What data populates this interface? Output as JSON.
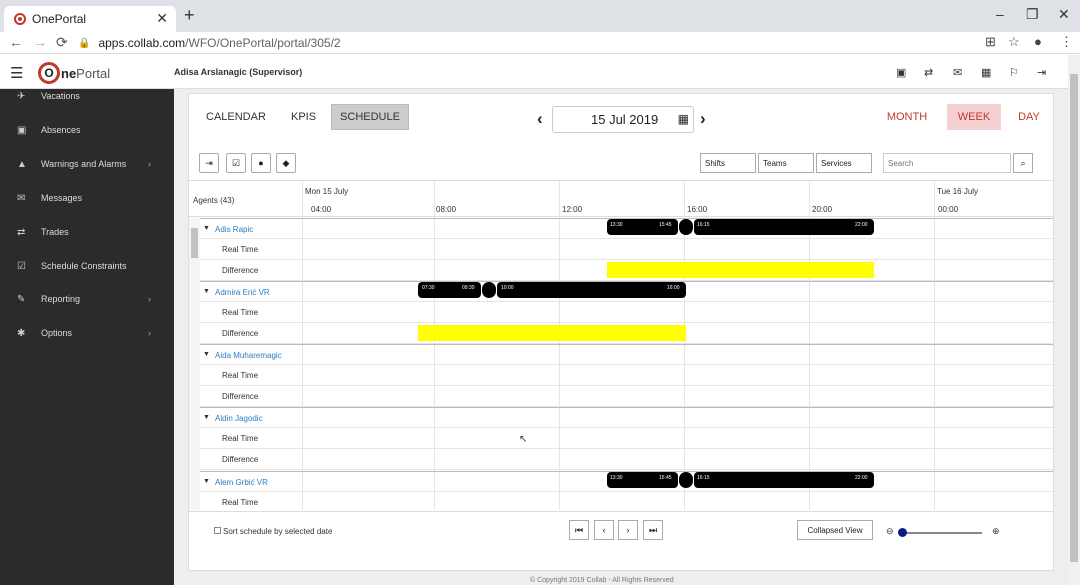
{
  "browser": {
    "tab_title": "OnePortal",
    "url_host": "apps.collab.com",
    "url_path": "/WFO/OnePortal/portal/305/2"
  },
  "app": {
    "logo_letter": "O",
    "logo_text_1": "ne",
    "logo_text_2": "Portal",
    "user_label": "Adisa Arslanagic (Supervisor)"
  },
  "sidebar": {
    "items": [
      {
        "label": "Vacations",
        "icon": "plane-icon"
      },
      {
        "label": "Absences",
        "icon": "calendar-x-icon"
      },
      {
        "label": "Warnings and Alarms",
        "icon": "warning-icon"
      },
      {
        "label": "Messages",
        "icon": "envelope-icon"
      },
      {
        "label": "Trades",
        "icon": "swap-icon"
      },
      {
        "label": "Schedule Constraints",
        "icon": "calendar-check-icon"
      },
      {
        "label": "Reporting",
        "icon": "edit-icon"
      },
      {
        "label": "Options",
        "icon": "gear-icon"
      }
    ]
  },
  "toolbar": {
    "calendar": "CALENDAR",
    "kpis": "KPIS",
    "schedule": "SCHEDULE",
    "date": "15 Jul 2019",
    "month": "MONTH",
    "week": "WEEK",
    "day": "DAY",
    "shifts": "Shifts",
    "teams": "Teams",
    "services": "Services",
    "search_placeholder": "Search"
  },
  "grid": {
    "agents_header": "Agents (43)",
    "day1": "Mon 15 July",
    "day2": "Tue 16 July",
    "hours": [
      "04:00",
      "08:00",
      "12:00",
      "16:00",
      "20:00",
      "00:00"
    ],
    "sub_real": "Real Time",
    "sub_diff": "Difference",
    "agents": [
      {
        "name": "Adis Rapic",
        "shift": [
          "13:30",
          "15:45",
          "16:15",
          "22:00"
        ]
      },
      {
        "name": "Admira Erić VR",
        "shift": [
          "07:30",
          "09:30",
          "10:00",
          "16:00"
        ]
      },
      {
        "name": "Aida Muharemagic"
      },
      {
        "name": "Aldin Jagodic"
      },
      {
        "name": "Alem Grbić VR",
        "shift": [
          "13:30",
          "15:45",
          "16:15",
          "22:00"
        ]
      }
    ]
  },
  "footer": {
    "sort_label": "Sort schedule by selected date",
    "collapsed_view": "Collapsed View"
  },
  "copyright": "© Copyright 2019 Collab - All Rights Reserved"
}
